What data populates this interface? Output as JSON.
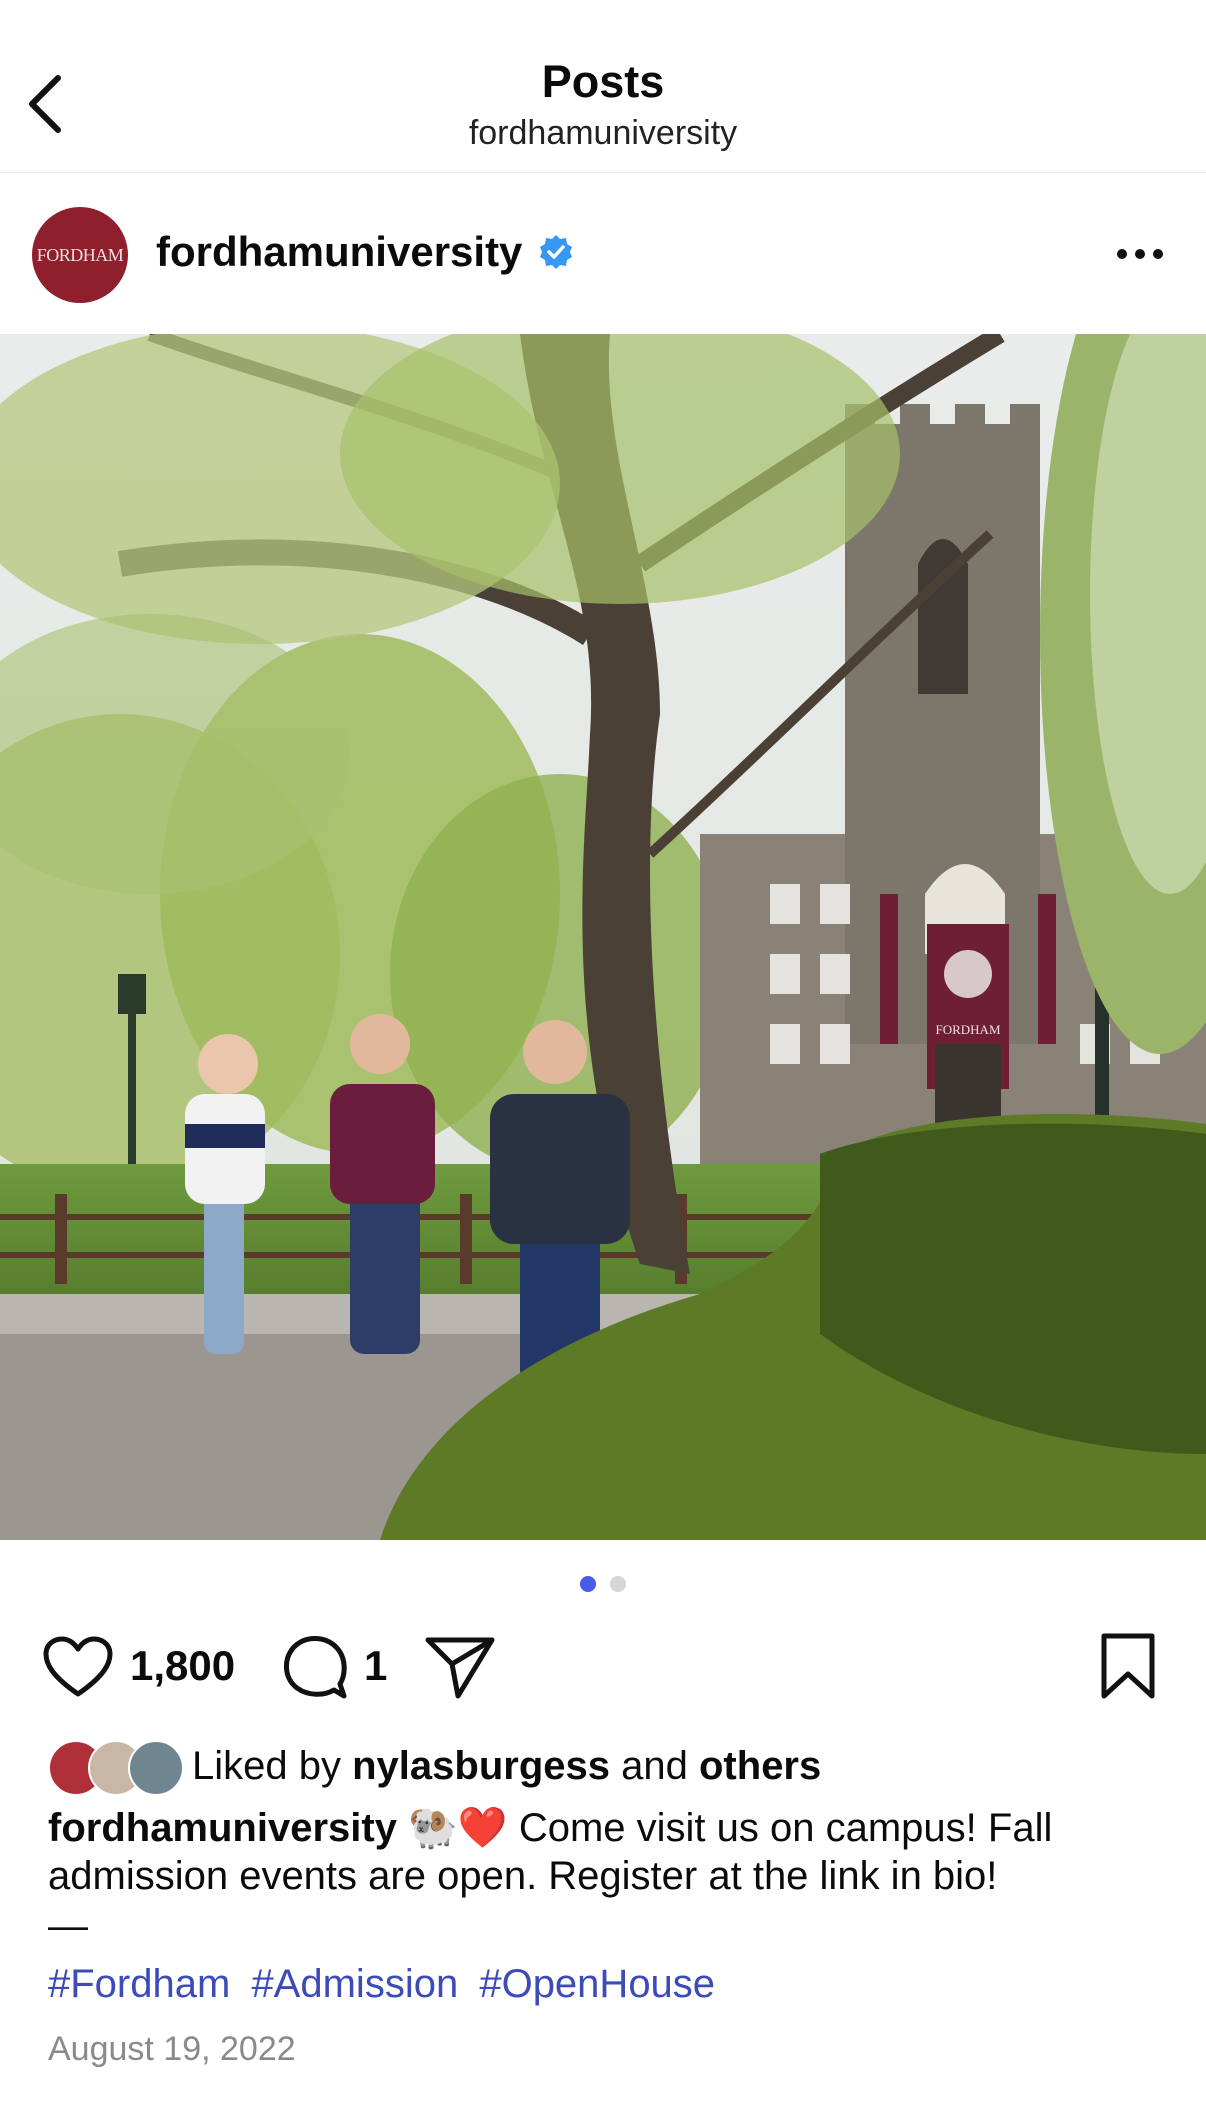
{
  "header": {
    "title": "Posts",
    "subtitle": "fordhamuniversity",
    "back_icon": "chevron-left-icon"
  },
  "post": {
    "avatar_text": "FORDHAM",
    "username": "fordhamuniversity",
    "verified_icon": "verified-badge-icon",
    "more_icon": "more-horizontal-icon",
    "photo_banner_text": "FORDHAM",
    "carousel": {
      "current": 1,
      "total": 2
    }
  },
  "actions": {
    "like_count": "1,800",
    "comment_count": "1"
  },
  "likes": {
    "prefix": "Liked by",
    "user": "nylasburgess",
    "conj": "and",
    "others": "others"
  },
  "caption": {
    "username": "fordhamuniversity",
    "emojis": "🐏❤️",
    "text": "Come visit us on campus! Fall admission events are open. Register at the link in bio!",
    "dash": "—",
    "hashtags": [
      "#Fordham",
      "#Admission",
      "#OpenHouse"
    ]
  },
  "date": "August 19, 2022",
  "colors": {
    "accent": "#4a5ce5",
    "hashtag": "#3b4bb8",
    "brand_maroon": "#8f1f2d",
    "verified": "#3897f0"
  }
}
